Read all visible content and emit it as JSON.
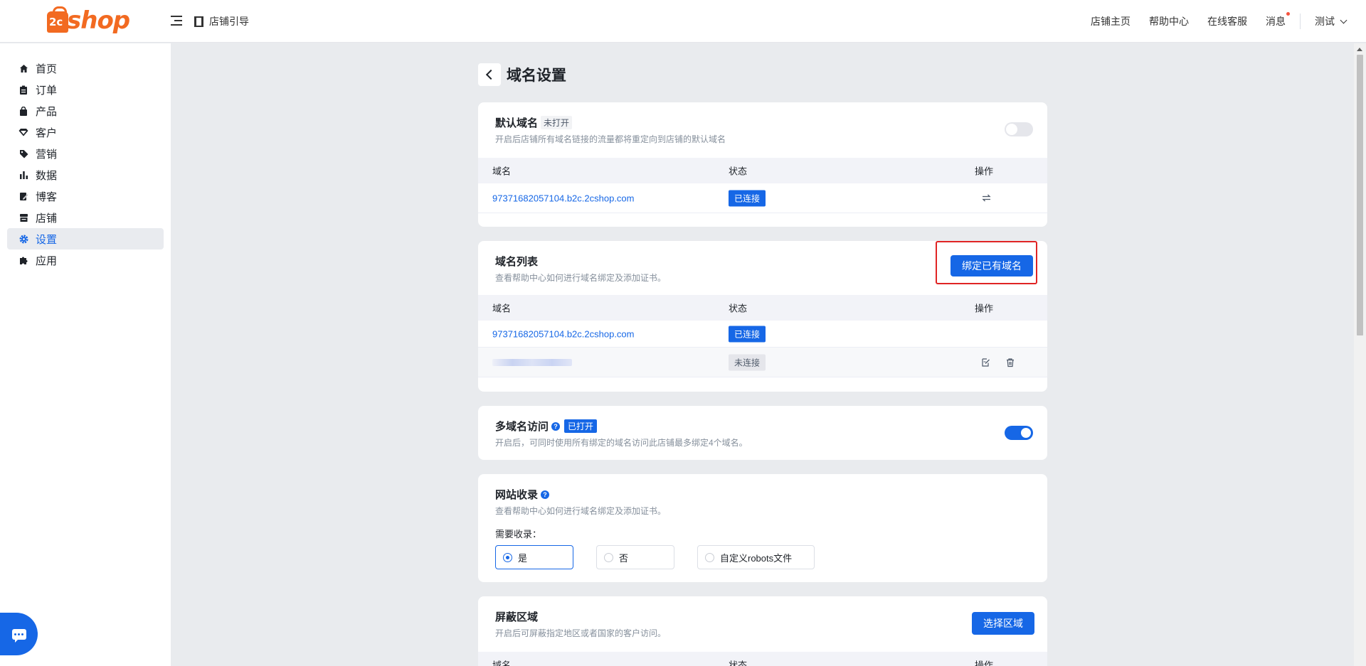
{
  "header": {
    "logo_badge": "2c",
    "logo_text": "shop",
    "guide_label": "店铺引导",
    "nav": [
      "店铺主页",
      "帮助中心",
      "在线客服",
      "消息"
    ],
    "user": "测试"
  },
  "sidebar": {
    "items": [
      {
        "label": "首页",
        "icon": "home-icon"
      },
      {
        "label": "订单",
        "icon": "clipboard-icon"
      },
      {
        "label": "产品",
        "icon": "bag-icon"
      },
      {
        "label": "客户",
        "icon": "diamond-icon"
      },
      {
        "label": "营销",
        "icon": "tag-icon"
      },
      {
        "label": "数据",
        "icon": "bar-chart-icon"
      },
      {
        "label": "博客",
        "icon": "edit-icon"
      },
      {
        "label": "店铺",
        "icon": "store-icon"
      },
      {
        "label": "设置",
        "icon": "gear-icon",
        "active": true
      },
      {
        "label": "应用",
        "icon": "puzzle-icon"
      }
    ]
  },
  "page": {
    "title": "域名设置"
  },
  "default_domain": {
    "title": "默认域名",
    "status_tag": "未打开",
    "desc": "开启后店铺所有域名链接的流量都将重定向到店铺的默认域名",
    "toggle_on": false,
    "columns": [
      "域名",
      "状态",
      "操作"
    ],
    "rows": [
      {
        "domain": "97371682057104.b2c.2cshop.com",
        "status": "已连接"
      }
    ]
  },
  "domain_list": {
    "title": "域名列表",
    "desc": "查看帮助中心如何进行域名绑定及添加证书。",
    "bind_button": "绑定已有域名",
    "columns": [
      "域名",
      "状态",
      "操作"
    ],
    "rows": [
      {
        "domain": "97371682057104.b2c.2cshop.com",
        "status": "已连接"
      },
      {
        "domain": "",
        "status": "未连接"
      }
    ]
  },
  "multi_domain": {
    "title": "多域名访问",
    "status_tag": "已打开",
    "desc": "开启后，可同时使用所有绑定的域名访问此店铺最多绑定4个域名。",
    "toggle_on": true
  },
  "indexing": {
    "title": "网站收录",
    "desc": "查看帮助中心如何进行域名绑定及添加证书。",
    "question": "需要收录：",
    "options": [
      "是",
      "否",
      "自定义robots文件"
    ],
    "selected": "是"
  },
  "block_region": {
    "title": "屏蔽区域",
    "desc": "开启后可屏蔽指定地区或者国家的客户访问。",
    "button": "选择区域",
    "columns": [
      "域名",
      "状态",
      "操作"
    ]
  },
  "colors": {
    "primary": "#1667e6",
    "brand": "#f26a21",
    "highlight": "#e02424"
  }
}
